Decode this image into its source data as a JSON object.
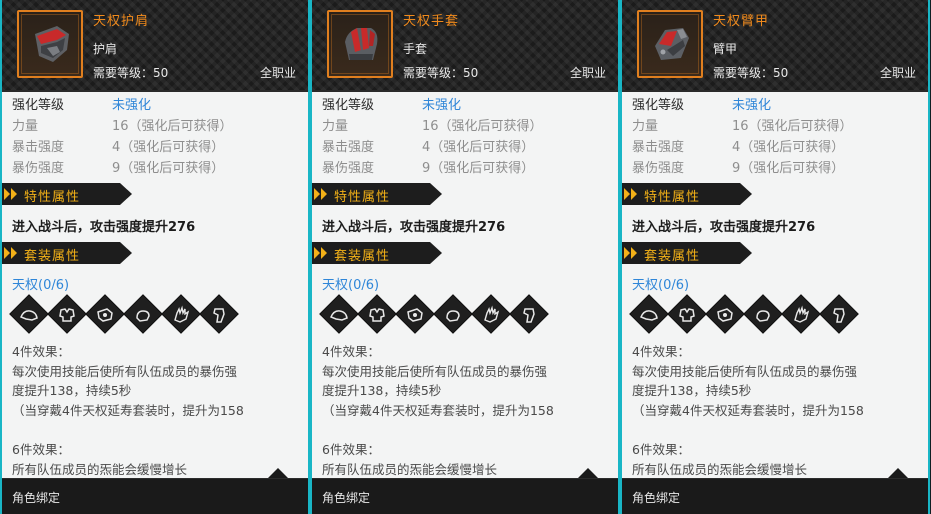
{
  "colors": {
    "accent_orange": "#f08a1c",
    "section_yellow": "#f3b118",
    "enhance_blue": "#2f86d8",
    "frame_cyan": "#19b6c6",
    "header_dark": "#1b1b1b"
  },
  "cards": [
    {
      "item_name": "天权护肩",
      "slot": "护肩",
      "icon": "shoulder-armor-icon",
      "level_req": "需要等级：50",
      "job": "全职业",
      "enhance_label": "强化等级",
      "enhance_value": "未强化",
      "stats": [
        {
          "label": "力量",
          "value": "16（强化后可获得）"
        },
        {
          "label": "暴击强度",
          "value": "4（强化后可获得）"
        },
        {
          "label": "暴伤强度",
          "value": "9（强化后可获得）"
        }
      ],
      "trait_title": "特性属性",
      "trait_text": "进入战斗后，攻击强度提升276",
      "set_title": "套装属性",
      "set_name": "天权(0/6)",
      "set_icons": [
        "shoulder-slot-icon",
        "chest-slot-icon",
        "arm-slot-icon",
        "glove-slot-icon",
        "hand-slot-icon",
        "leg-slot-icon"
      ],
      "bonus4_title": "4件效果：",
      "bonus4_lines": [
        "每次使用技能后使所有队伍成员的暴伤强",
        "度提升138，持续5秒",
        "（当穿戴4件天权延寿套装时，提升为158"
      ],
      "bonus6_title": "6件效果：",
      "bonus6_line": "所有队伍成员的炁能会缓慢增长",
      "footer": "角色绑定"
    },
    {
      "item_name": "天权手套",
      "slot": "手套",
      "icon": "glove-icon",
      "level_req": "需要等级：50",
      "job": "全职业",
      "enhance_label": "强化等级",
      "enhance_value": "未强化",
      "stats": [
        {
          "label": "力量",
          "value": "16（强化后可获得）"
        },
        {
          "label": "暴击强度",
          "value": "4（强化后可获得）"
        },
        {
          "label": "暴伤强度",
          "value": "9（强化后可获得）"
        }
      ],
      "trait_title": "特性属性",
      "trait_text": "进入战斗后，攻击强度提升276",
      "set_title": "套装属性",
      "set_name": "天权(0/6)",
      "set_icons": [
        "shoulder-slot-icon",
        "chest-slot-icon",
        "arm-slot-icon",
        "glove-slot-icon",
        "hand-slot-icon",
        "leg-slot-icon"
      ],
      "bonus4_title": "4件效果：",
      "bonus4_lines": [
        "每次使用技能后使所有队伍成员的暴伤强",
        "度提升138，持续5秒",
        "（当穿戴4件天权延寿套装时，提升为158"
      ],
      "bonus6_title": "6件效果：",
      "bonus6_line": "所有队伍成员的炁能会缓慢增长",
      "footer": "角色绑定"
    },
    {
      "item_name": "天权臂甲",
      "slot": "臂甲",
      "icon": "arm-guard-icon",
      "level_req": "需要等级：50",
      "job": "全职业",
      "enhance_label": "强化等级",
      "enhance_value": "未强化",
      "stats": [
        {
          "label": "力量",
          "value": "16（强化后可获得）"
        },
        {
          "label": "暴击强度",
          "value": "4（强化后可获得）"
        },
        {
          "label": "暴伤强度",
          "value": "9（强化后可获得）"
        }
      ],
      "trait_title": "特性属性",
      "trait_text": "进入战斗后，攻击强度提升276",
      "set_title": "套装属性",
      "set_name": "天权(0/6)",
      "set_icons": [
        "shoulder-slot-icon",
        "chest-slot-icon",
        "arm-slot-icon",
        "glove-slot-icon",
        "hand-slot-icon",
        "leg-slot-icon"
      ],
      "bonus4_title": "4件效果：",
      "bonus4_lines": [
        "每次使用技能后使所有队伍成员的暴伤强",
        "度提升138，持续5秒",
        "（当穿戴4件天权延寿套装时，提升为158"
      ],
      "bonus6_title": "6件效果：",
      "bonus6_line": "所有队伍成员的炁能会缓慢增长",
      "footer": "角色绑定"
    }
  ]
}
